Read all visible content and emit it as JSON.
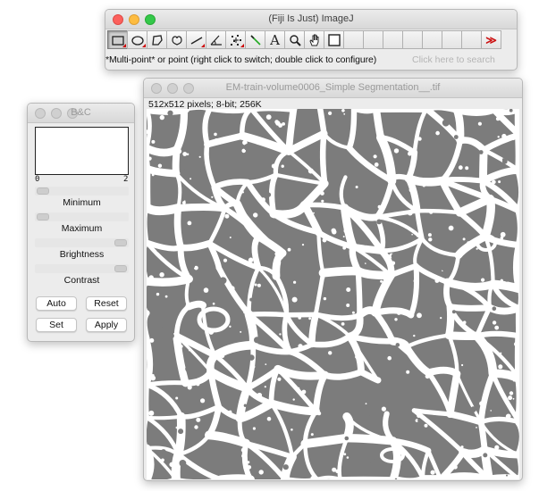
{
  "imagej": {
    "title": "(Fiji Is Just) ImageJ",
    "tools": [
      {
        "name": "rectangle-tool-icon",
        "glyph": "",
        "selected": true,
        "menu": true
      },
      {
        "name": "oval-tool-icon",
        "glyph": "",
        "selected": false,
        "menu": true
      },
      {
        "name": "polygon-tool-icon",
        "glyph": "",
        "selected": false,
        "menu": false
      },
      {
        "name": "freehand-tool-icon",
        "glyph": "",
        "selected": false,
        "menu": false
      },
      {
        "name": "line-tool-icon",
        "glyph": "",
        "selected": false,
        "menu": true
      },
      {
        "name": "angle-tool-icon",
        "glyph": "",
        "selected": false,
        "menu": false
      },
      {
        "name": "multipoint-tool-icon",
        "glyph": "",
        "selected": false,
        "menu": true
      },
      {
        "name": "wand-tool-icon",
        "glyph": "",
        "selected": false,
        "menu": false
      },
      {
        "name": "text-tool-icon",
        "glyph": "A",
        "selected": false,
        "menu": false
      },
      {
        "name": "magnifier-tool-icon",
        "glyph": "",
        "selected": false,
        "menu": false
      },
      {
        "name": "hand-tool-icon",
        "glyph": "",
        "selected": false,
        "menu": false
      },
      {
        "name": "color-picker-tool-icon",
        "glyph": "",
        "selected": false,
        "menu": false
      }
    ],
    "more_glyph": "≫",
    "status": "*Multi-point* or point (right click to switch; double click to configure)",
    "search_placeholder": "Click here to search"
  },
  "bc": {
    "title": "B&C",
    "hist_min": "0",
    "hist_max": "2",
    "minimum_label": "Minimum",
    "maximum_label": "Maximum",
    "brightness_label": "Brightness",
    "contrast_label": "Contrast",
    "minimum_value": 0.0,
    "maximum_value": 0.0,
    "brightness_value": 1.0,
    "contrast_value": 1.0,
    "buttons": {
      "auto": "Auto",
      "reset": "Reset",
      "set": "Set",
      "apply": "Apply"
    }
  },
  "image_window": {
    "title": "EM-train-volume0006_Simple Segmentation__.tif",
    "info": "512x512 pixels; 8-bit; 256K",
    "background_color": "#7c7c7c",
    "foreground_color": "#ffffff"
  }
}
